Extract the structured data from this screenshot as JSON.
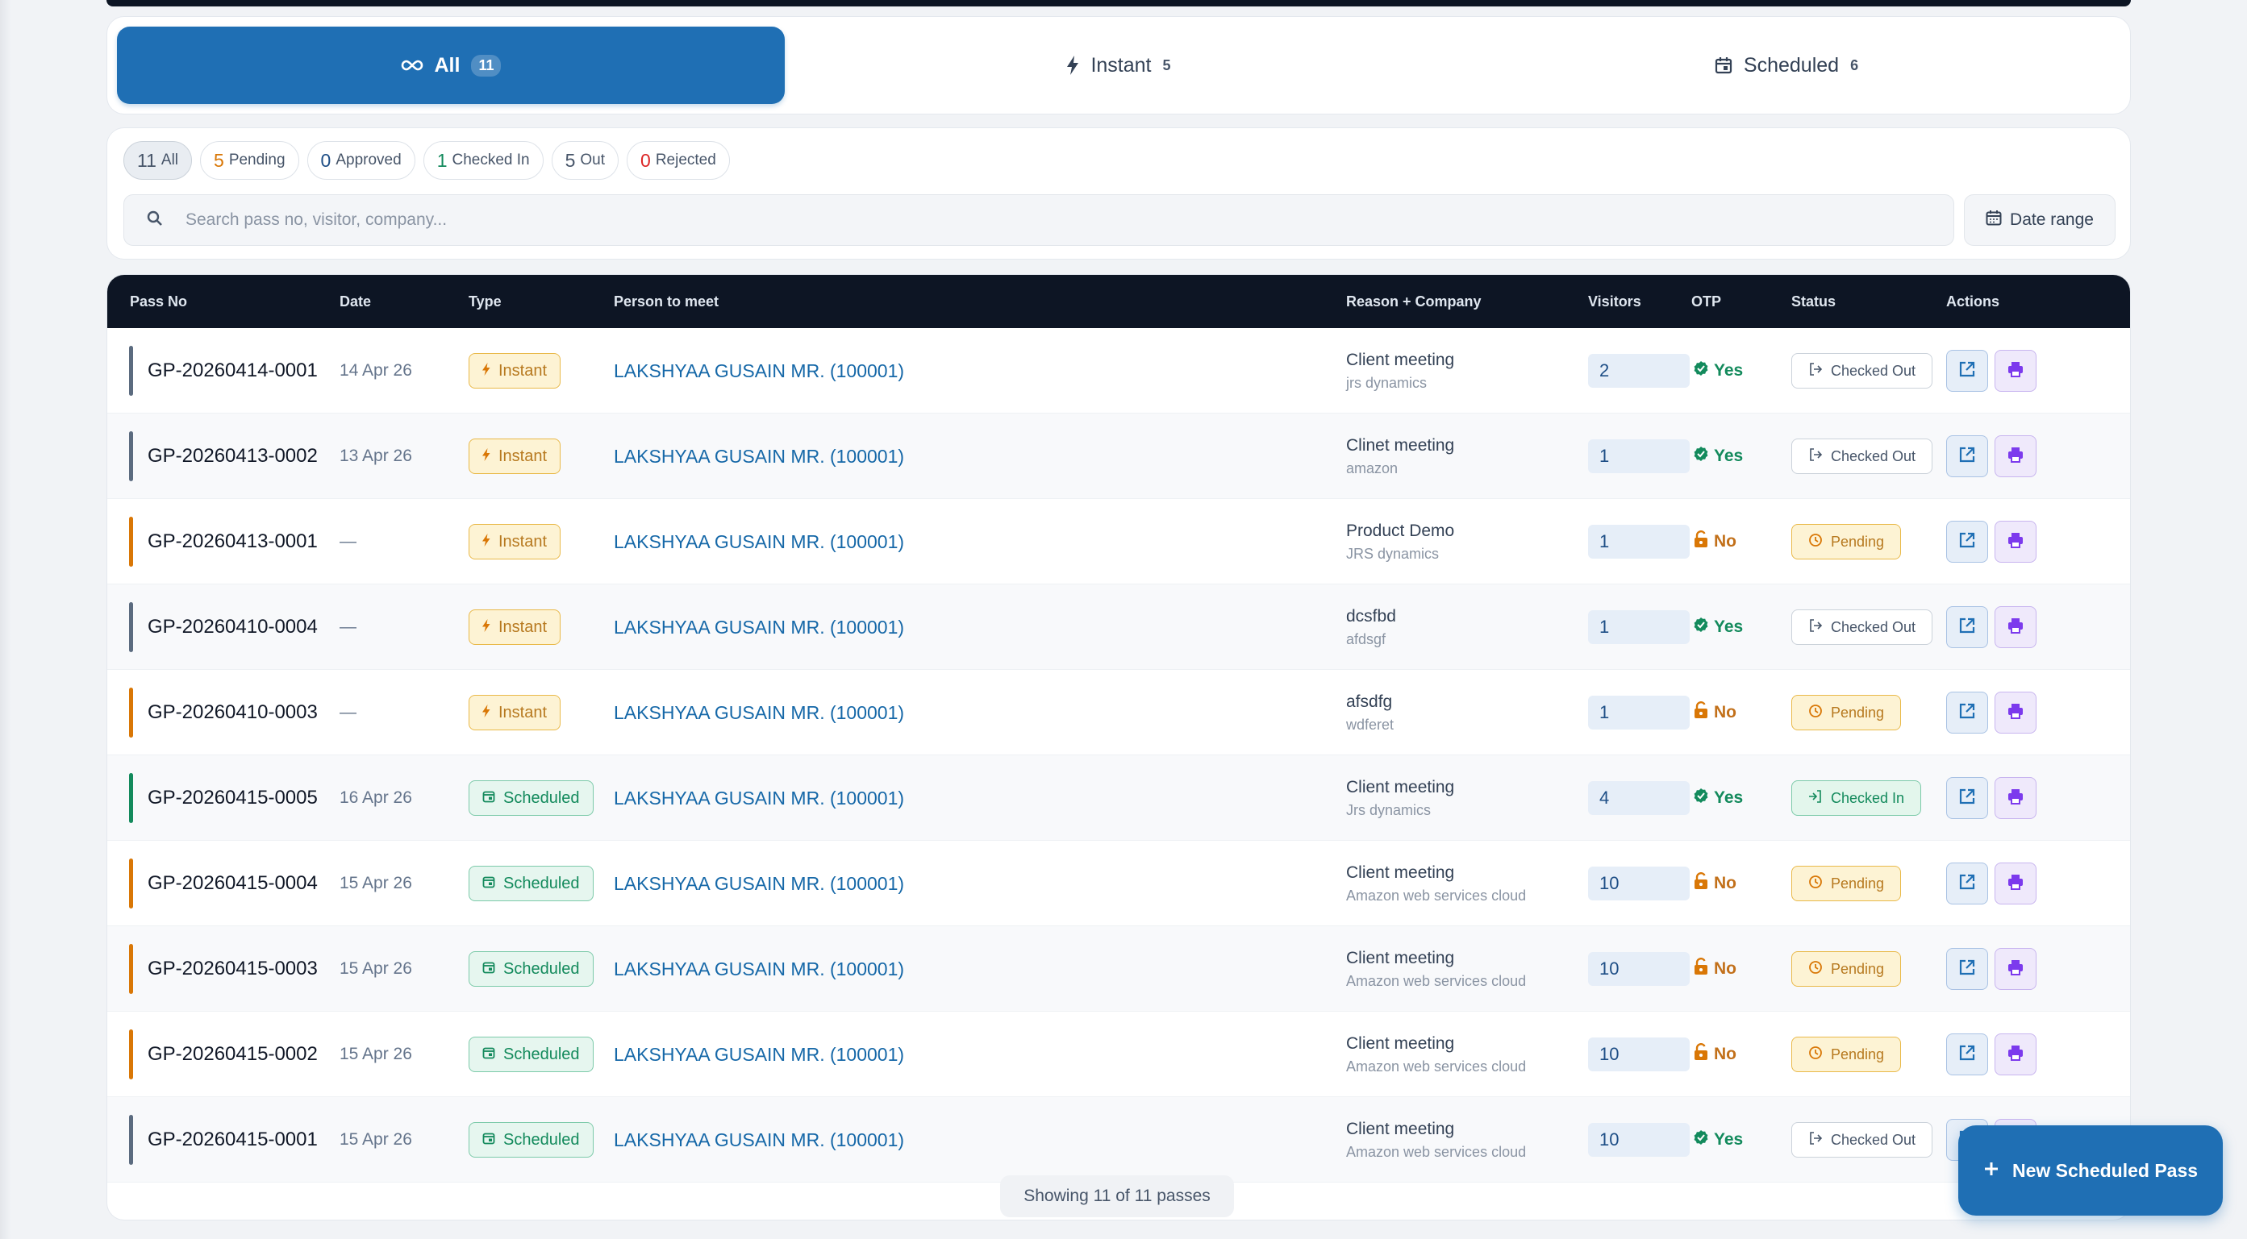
{
  "tabs": [
    {
      "label": "All",
      "count": "11",
      "icon": "infinity-icon"
    },
    {
      "label": "Instant",
      "count": "5",
      "icon": "bolt-icon"
    },
    {
      "label": "Scheduled",
      "count": "6",
      "icon": "calendar-icon"
    }
  ],
  "filters": [
    {
      "count": "11",
      "label": "All",
      "color": "#475569"
    },
    {
      "count": "5",
      "label": "Pending",
      "color": "#d97706"
    },
    {
      "count": "0",
      "label": "Approved",
      "color": "#1e4e86"
    },
    {
      "count": "1",
      "label": "Checked In",
      "color": "#138a5c"
    },
    {
      "count": "5",
      "label": "Out",
      "color": "#475569"
    },
    {
      "count": "0",
      "label": "Rejected",
      "color": "#dc2626"
    }
  ],
  "search": {
    "placeholder": "Search pass no, visitor, company..."
  },
  "date_range_label": "Date range",
  "table": {
    "columns": [
      "Pass No",
      "Date",
      "Type",
      "Person to meet",
      "Reason + Company",
      "Visitors",
      "OTP",
      "Status",
      "Actions"
    ],
    "rows": [
      {
        "pass_no": "GP-20260414-0001",
        "date": "14 Apr 26",
        "type": "Instant",
        "person": "LAKSHYAA GUSAIN MR. (100001)",
        "reason": "Client meeting",
        "company": "jrs dynamics",
        "visitors": "2",
        "otp": "Yes",
        "status": "Checked Out"
      },
      {
        "pass_no": "GP-20260413-0002",
        "date": "13 Apr 26",
        "type": "Instant",
        "person": "LAKSHYAA GUSAIN MR. (100001)",
        "reason": "Clinet meeting",
        "company": "amazon",
        "visitors": "1",
        "otp": "Yes",
        "status": "Checked Out"
      },
      {
        "pass_no": "GP-20260413-0001",
        "date": "—",
        "type": "Instant",
        "person": "LAKSHYAA GUSAIN MR. (100001)",
        "reason": "Product Demo",
        "company": "JRS dynamics",
        "visitors": "1",
        "otp": "No",
        "status": "Pending"
      },
      {
        "pass_no": "GP-20260410-0004",
        "date": "—",
        "type": "Instant",
        "person": "LAKSHYAA GUSAIN MR. (100001)",
        "reason": "dcsfbd",
        "company": "afdsgf",
        "visitors": "1",
        "otp": "Yes",
        "status": "Checked Out"
      },
      {
        "pass_no": "GP-20260410-0003",
        "date": "—",
        "type": "Instant",
        "person": "LAKSHYAA GUSAIN MR. (100001)",
        "reason": "afsdfg",
        "company": "wdferet",
        "visitors": "1",
        "otp": "No",
        "status": "Pending"
      },
      {
        "pass_no": "GP-20260415-0005",
        "date": "16 Apr 26",
        "type": "Scheduled",
        "person": "LAKSHYAA GUSAIN MR. (100001)",
        "reason": "Client meeting",
        "company": "Jrs dynamics",
        "visitors": "4",
        "otp": "Yes",
        "status": "Checked In"
      },
      {
        "pass_no": "GP-20260415-0004",
        "date": "15 Apr 26",
        "type": "Scheduled",
        "person": "LAKSHYAA GUSAIN MR. (100001)",
        "reason": "Client meeting",
        "company": "Amazon web services cloud",
        "visitors": "10",
        "otp": "No",
        "status": "Pending"
      },
      {
        "pass_no": "GP-20260415-0003",
        "date": "15 Apr 26",
        "type": "Scheduled",
        "person": "LAKSHYAA GUSAIN MR. (100001)",
        "reason": "Client meeting",
        "company": "Amazon web services cloud",
        "visitors": "10",
        "otp": "No",
        "status": "Pending"
      },
      {
        "pass_no": "GP-20260415-0002",
        "date": "15 Apr 26",
        "type": "Scheduled",
        "person": "LAKSHYAA GUSAIN MR. (100001)",
        "reason": "Client meeting",
        "company": "Amazon web services cloud",
        "visitors": "10",
        "otp": "No",
        "status": "Pending"
      },
      {
        "pass_no": "GP-20260415-0001",
        "date": "15 Apr 26",
        "type": "Scheduled",
        "person": "LAKSHYAA GUSAIN MR. (100001)",
        "reason": "Client meeting",
        "company": "Amazon web services cloud",
        "visitors": "10",
        "otp": "Yes",
        "status": "Checked Out"
      }
    ]
  },
  "footer": {
    "showing": "Showing 11 of 11 passes"
  },
  "fab_label": "New Scheduled Pass",
  "colors": {
    "primary": "#1f6fb4",
    "header_dark": "#0d1524",
    "pending": "#d97706",
    "success": "#138a5c",
    "checked_out_accent": "#5b6b7f"
  }
}
